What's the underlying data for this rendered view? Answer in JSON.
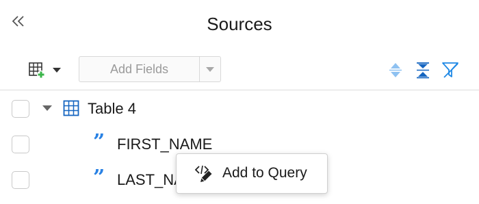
{
  "header": {
    "title": "Sources",
    "collapse_icon": "double-chevron-left-icon"
  },
  "toolbar": {
    "table_menu_icon": "add-table-icon",
    "add_fields_placeholder": "Add Fields",
    "sort_icon": "sort-icon",
    "collapse_all_icon": "collapse-all-icon",
    "filter_icon": "filter-icon"
  },
  "tree": {
    "table": {
      "label": "Table 4",
      "expanded": true
    },
    "fields": [
      {
        "label": "FIRST_NAME",
        "type_icon": "string-type-icon"
      },
      {
        "label": "LAST_NA",
        "type_icon": "string-type-icon"
      }
    ]
  },
  "context_menu": {
    "items": [
      {
        "label": "Add to Query",
        "icon": "edit-code-icon"
      }
    ]
  },
  "colors": {
    "accent": "#2a82e4",
    "light_accent": "#8ec1f1",
    "divider": "#dcdcdc",
    "checkbox_border": "#c9c9c9",
    "placeholder_text": "#9a9a9a"
  }
}
